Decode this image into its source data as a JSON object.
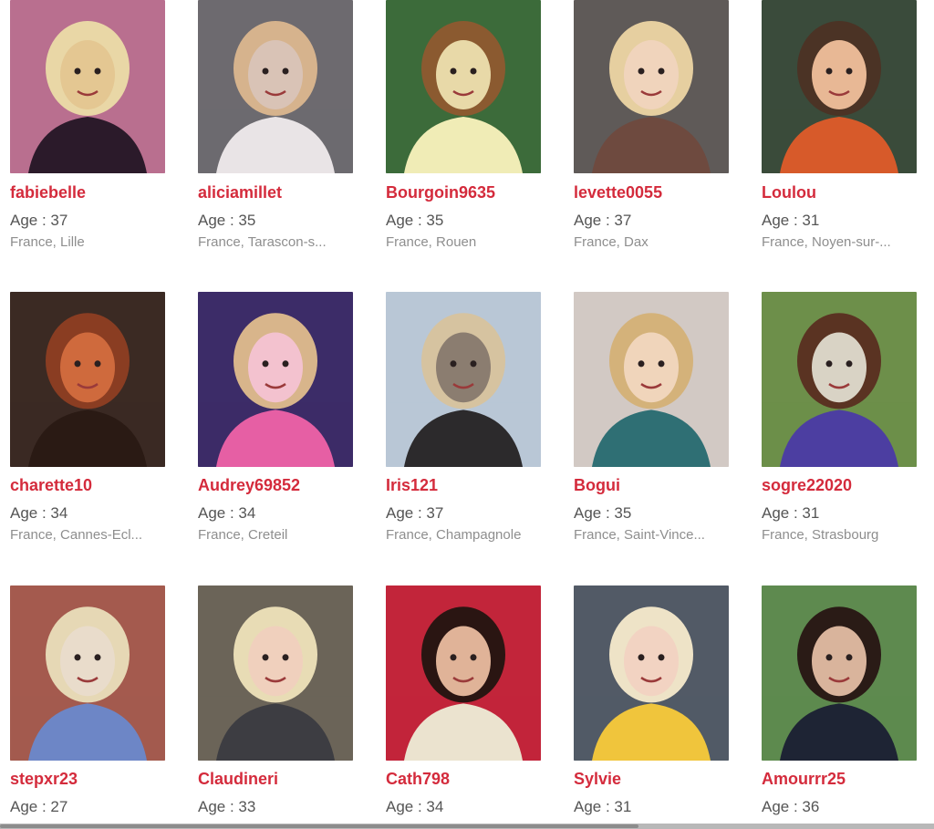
{
  "profiles": [
    {
      "username": "fabiebelle",
      "age": "Age : 37",
      "location": "France, Lille",
      "photo": {
        "bg": "#b96f8f",
        "accent": "#e4c792",
        "body": "#2b1a2a",
        "hair": "#e9d7a6"
      }
    },
    {
      "username": "aliciamillet",
      "age": "Age : 35",
      "location": "France, Tarascon-s...",
      "photo": {
        "bg": "#6d6a6f",
        "accent": "#d9c3b6",
        "body": "#e9e4e6",
        "hair": "#d6b38d"
      }
    },
    {
      "username": "Bourgoin9635",
      "age": "Age : 35",
      "location": "France, Rouen",
      "photo": {
        "bg": "#3c6b3a",
        "accent": "#e8d9a8",
        "body": "#f0ecb6",
        "hair": "#8b5a30"
      }
    },
    {
      "username": "levette0055",
      "age": "Age : 37",
      "location": "France, Dax",
      "photo": {
        "bg": "#5f5a58",
        "accent": "#f0d4bc",
        "body": "#6e4a3f",
        "hair": "#e6cfa0"
      }
    },
    {
      "username": "Loulou",
      "age": "Age : 31",
      "location": "France, Noyen-sur-...",
      "photo": {
        "bg": "#3a4b3b",
        "accent": "#e8b895",
        "body": "#d75a2a",
        "hair": "#4b3325"
      }
    },
    {
      "username": "charette10",
      "age": "Age : 34",
      "location": "France, Cannes-Ecl...",
      "photo": {
        "bg": "#3b2a23",
        "accent": "#cf6a3d",
        "body": "#2a1a14",
        "hair": "#8a3d22"
      }
    },
    {
      "username": "Audrey69852",
      "age": "Age : 34",
      "location": "France, Creteil",
      "photo": {
        "bg": "#3c2c68",
        "accent": "#f3c2cf",
        "body": "#e65fa4",
        "hair": "#d8b58b"
      }
    },
    {
      "username": "Iris121",
      "age": "Age : 37",
      "location": "France, Champagnole",
      "photo": {
        "bg": "#b9c7d6",
        "accent": "#8b7d70",
        "body": "#2c2a2c",
        "hair": "#d6c3a0"
      }
    },
    {
      "username": "Bogui",
      "age": "Age : 35",
      "location": "France, Saint-Vince...",
      "photo": {
        "bg": "#d2c9c4",
        "accent": "#f0d5bb",
        "body": "#2f6f74",
        "hair": "#d4b27a"
      }
    },
    {
      "username": "sogre22020",
      "age": "Age : 31",
      "location": "France, Strasbourg",
      "photo": {
        "bg": "#6d8f4a",
        "accent": "#d9d3c5",
        "body": "#4c3ea1",
        "hair": "#5a3322"
      }
    },
    {
      "username": "stepxr23",
      "age": "Age : 27",
      "location": "",
      "photo": {
        "bg": "#a45a4e",
        "accent": "#e9dccb",
        "body": "#6d86c6",
        "hair": "#e6d8b5"
      }
    },
    {
      "username": "Claudineri",
      "age": "Age : 33",
      "location": "",
      "photo": {
        "bg": "#6b6458",
        "accent": "#f0d0bd",
        "body": "#3d3d42",
        "hair": "#e8dcb5"
      }
    },
    {
      "username": "Cath798",
      "age": "Age : 34",
      "location": "",
      "photo": {
        "bg": "#c2253a",
        "accent": "#e0b398",
        "body": "#ebe3cf",
        "hair": "#2a1512"
      }
    },
    {
      "username": "Sylvie",
      "age": "Age : 31",
      "location": "",
      "photo": {
        "bg": "#525a66",
        "accent": "#f2d3c2",
        "body": "#f0c53c",
        "hair": "#eee3c7"
      }
    },
    {
      "username": "Amourrr25",
      "age": "Age : 36",
      "location": "",
      "photo": {
        "bg": "#5e8a4f",
        "accent": "#d9b49c",
        "body": "#1e2434",
        "hair": "#2a1b16"
      }
    }
  ]
}
